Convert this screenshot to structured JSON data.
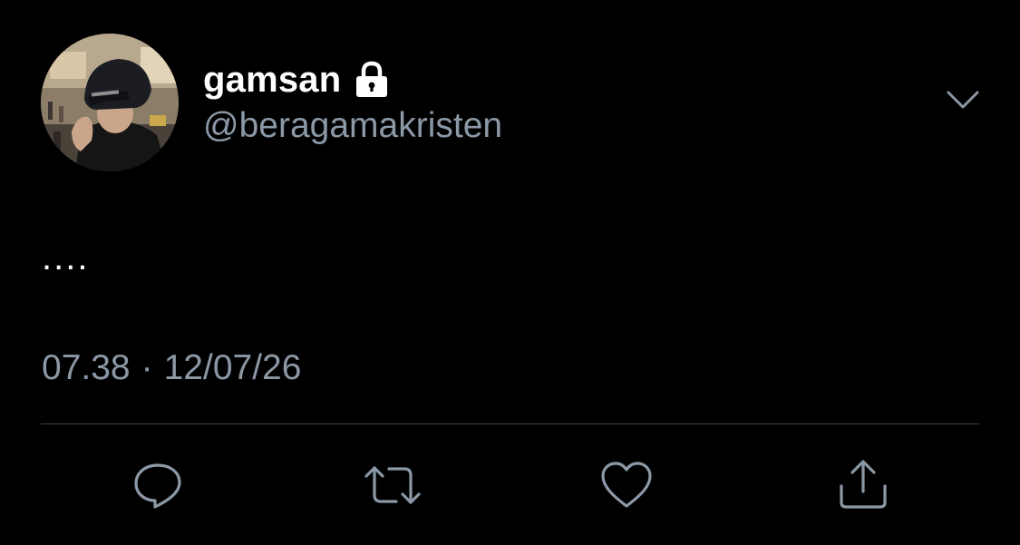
{
  "tweet": {
    "display_name": "gamsan",
    "handle": "@beragamakristen",
    "text": "....",
    "time": "07.38",
    "separator": "·",
    "date": "12/07/26",
    "protected_icon": "lock-icon",
    "more_icon": "chevron-down-icon"
  },
  "actions": [
    {
      "name": "reply",
      "icon": "speech-bubble-icon"
    },
    {
      "name": "retweet",
      "icon": "retweet-icon"
    },
    {
      "name": "like",
      "icon": "heart-icon"
    },
    {
      "name": "share",
      "icon": "share-icon"
    }
  ],
  "colors": {
    "background": "#000000",
    "primary_text": "#ffffff",
    "secondary_text": "#8b98a5",
    "divider": "#38444d"
  }
}
